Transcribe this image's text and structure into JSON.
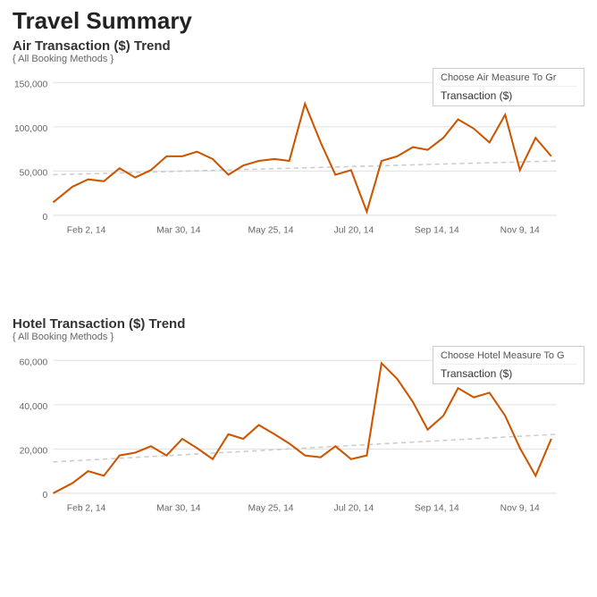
{
  "page": {
    "title": "Travel Summary"
  },
  "air_chart": {
    "title": "Air Transaction ($) Trend",
    "subtitle": "{ All Booking Methods }",
    "measure_label": "Choose Air Measure To Gr",
    "measure_value": "Transaction ($)",
    "x_labels": [
      "Feb 2, 14",
      "Mar 30, 14",
      "May 25, 14",
      "Jul 20, 14",
      "Sep 14, 14",
      "Nov 9, 14"
    ]
  },
  "hotel_chart": {
    "title": "Hotel Transaction ($) Trend",
    "subtitle": "{ All Booking Methods }",
    "measure_label": "Choose Hotel Measure To G",
    "measure_value": "Transaction ($)",
    "x_labels": [
      "Feb 2, 14",
      "Mar 30, 14",
      "May 25, 14",
      "Jul 20, 14",
      "Sep 14, 14",
      "Nov 9, 14"
    ]
  }
}
